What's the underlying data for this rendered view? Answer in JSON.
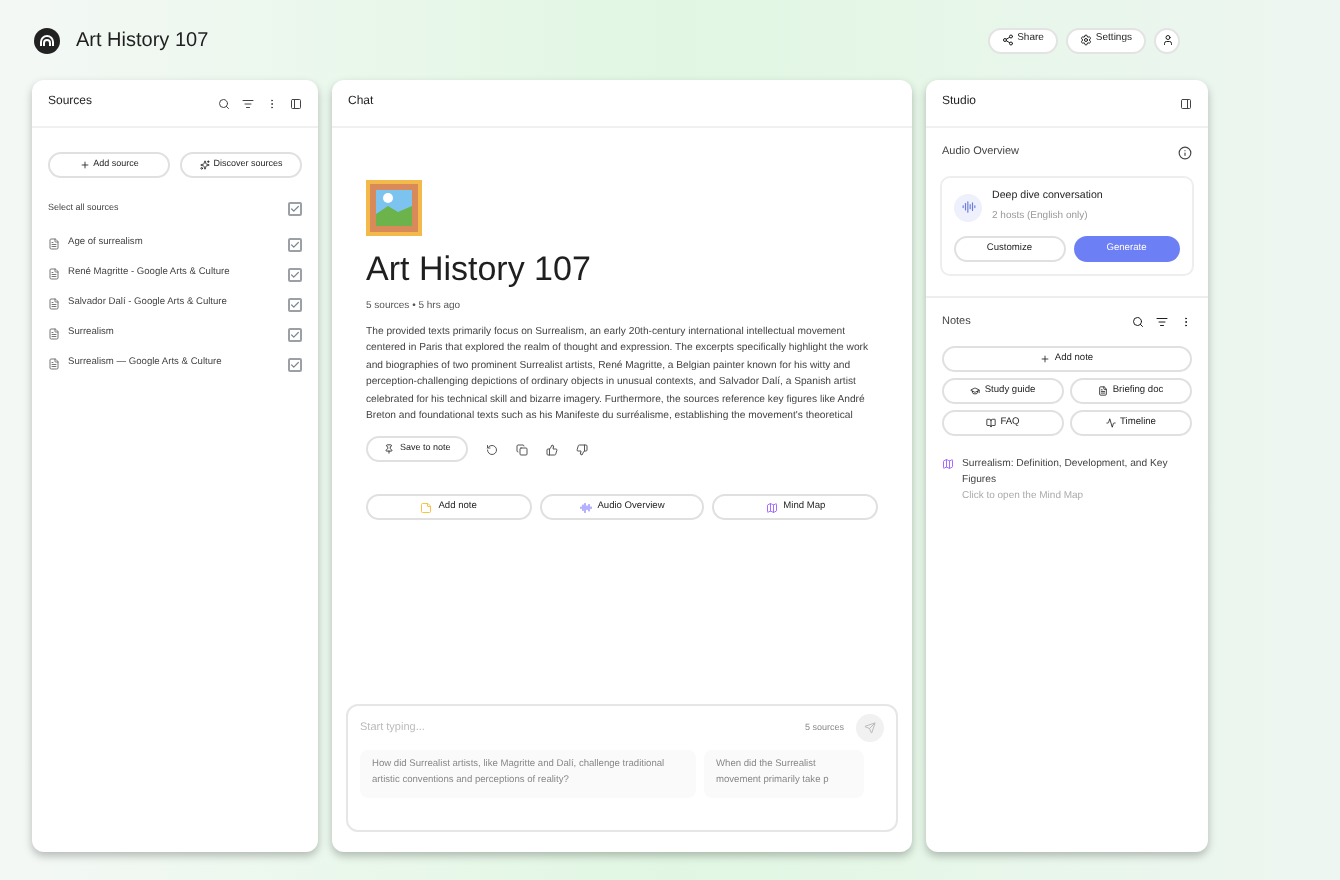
{
  "header": {
    "title": "Art History 107",
    "buttons": [
      {
        "kind": "share",
        "label": "Share"
      },
      {
        "kind": "settings",
        "label": "Settings"
      }
    ]
  },
  "sources": {
    "title": "Sources",
    "add_button": "Add source",
    "discover_button": "Discover sources",
    "select_all": {
      "label": "Select all sources",
      "checked": true
    },
    "items": [
      {
        "label": "Age of surrealism",
        "checked": true
      },
      {
        "label": "René Magritte - Google Arts & Culture",
        "checked": true
      },
      {
        "label": "Salvador Dalí - Google Arts & Culture",
        "checked": true
      },
      {
        "label": "Surrealism",
        "checked": true
      },
      {
        "label": "Surrealism — Google Arts & Culture",
        "checked": true
      }
    ]
  },
  "chat": {
    "title": "Chat",
    "notebook_title": "Art History 107",
    "meta": "5 sources • 5 hrs ago",
    "summary": "The provided texts primarily focus on Surrealism, an early 20th-century international intellectual movement centered in Paris that explored the realm of thought and expression. The excerpts specifically highlight the work and biographies of two prominent Surrealist artists, René Magritte, a Belgian painter known for his witty and perception-challenging depictions of ordinary objects in unusual contexts, and Salvador Dalí, a Spanish artist celebrated for his technical skill and bizarre imagery. Furthermore, the sources reference key figures like André Breton and foundational texts such as his Manifeste du surréalisme, establishing the movement's theoretical",
    "save_button": "Save to note",
    "actions": [
      {
        "kind": "note",
        "label": "Add note"
      },
      {
        "kind": "audio",
        "label": "Audio Overview"
      },
      {
        "kind": "map",
        "label": "Mind Map"
      }
    ],
    "input": {
      "placeholder": "Start typing...",
      "source_count": "5 sources"
    },
    "suggestions": [
      "How did Surrealist artists, like Magritte and Dalí, challenge traditional artistic conventions and perceptions of reality?",
      "When did the Surrealist movement primarily take p"
    ]
  },
  "studio": {
    "title": "Studio",
    "audio": {
      "title": "Audio Overview",
      "card_title": "Deep dive conversation",
      "card_subtitle": "2 hosts (English only)",
      "customize": "Customize",
      "generate": "Generate"
    },
    "notes": {
      "title": "Notes",
      "add_button": "Add note",
      "tools": [
        {
          "kind": "guide",
          "label": "Study guide"
        },
        {
          "kind": "doc",
          "label": "Briefing doc"
        },
        {
          "kind": "faq",
          "label": "FAQ"
        },
        {
          "kind": "timeline",
          "label": "Timeline"
        }
      ],
      "items": [
        {
          "title": "Surrealism: Definition, Development, and Key Figures",
          "subtitle": "Click to open the Mind Map"
        }
      ]
    }
  }
}
